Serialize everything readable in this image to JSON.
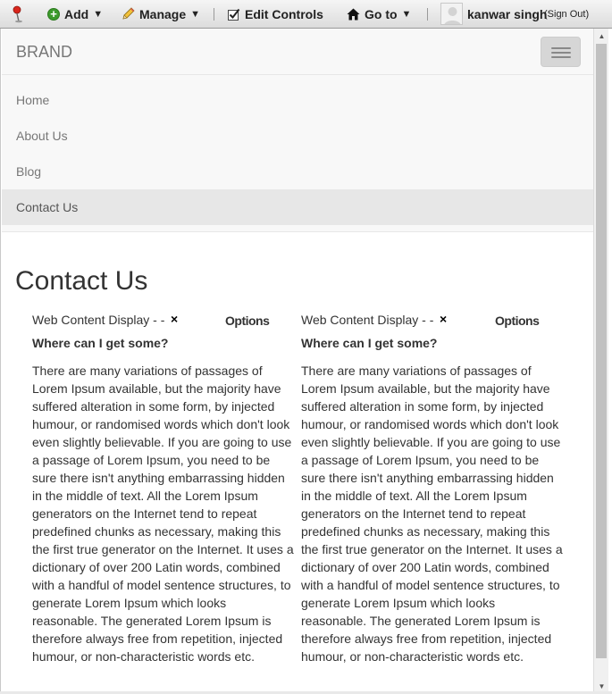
{
  "dockbar": {
    "add_label": "Add",
    "manage_label": "Manage",
    "edit_controls_label": "Edit Controls",
    "goto_label": "Go to",
    "user_name": "kanwar singh",
    "sign_out_label": "(Sign Out)",
    "caret": "▼"
  },
  "navbar": {
    "brand": "BRAND",
    "items": [
      {
        "label": "Home"
      },
      {
        "label": "About Us"
      },
      {
        "label": "Blog"
      },
      {
        "label": "Contact Us"
      }
    ]
  },
  "page": {
    "title": "Contact Us"
  },
  "portlets": [
    {
      "title": "Web Content Display - -",
      "close": "×",
      "options": "Options",
      "heading": "Where can I get some?",
      "body": "There are many variations of passages of Lorem Ipsum available, but the majority have suffered alteration in some form, by injected humour, or randomised words which don't look even slightly believable. If you are going to use a passage of Lorem Ipsum, you need to be sure there isn't anything embarrassing hidden in the middle of text. All the Lorem Ipsum generators on the Internet tend to repeat predefined chunks as necessary, making this the first true generator on the Internet. It uses a dictionary of over 200 Latin words, combined with a handful of model sentence structures, to generate Lorem Ipsum which looks reasonable. The generated Lorem Ipsum is therefore always free from repetition, injected humour, or non-characteristic words etc."
    },
    {
      "title": "Web Content Display - -",
      "close": "×",
      "options": "Options",
      "heading": "Where can I get some?",
      "body": "There are many variations of passages of Lorem Ipsum available, but the majority have suffered alteration in some form, by injected humour, or randomised words which don't look even slightly believable. If you are going to use a passage of Lorem Ipsum, you need to be sure there isn't anything embarrassing hidden in the middle of text. All the Lorem Ipsum generators on the Internet tend to repeat predefined chunks as necessary, making this the first true generator on the Internet. It uses a dictionary of over 200 Latin words, combined with a handful of model sentence structures, to generate Lorem Ipsum which looks reasonable. The generated Lorem Ipsum is therefore always free from repetition, injected humour, or non-characteristic words etc."
    }
  ],
  "icons": {
    "pin": "pin-icon",
    "add": "add-icon",
    "manage": "pencil-icon",
    "edit_controls": "checkbox-icon",
    "goto": "home-icon",
    "close": "close-icon",
    "options": "gear-icon",
    "menu": "hamburger-icon"
  }
}
